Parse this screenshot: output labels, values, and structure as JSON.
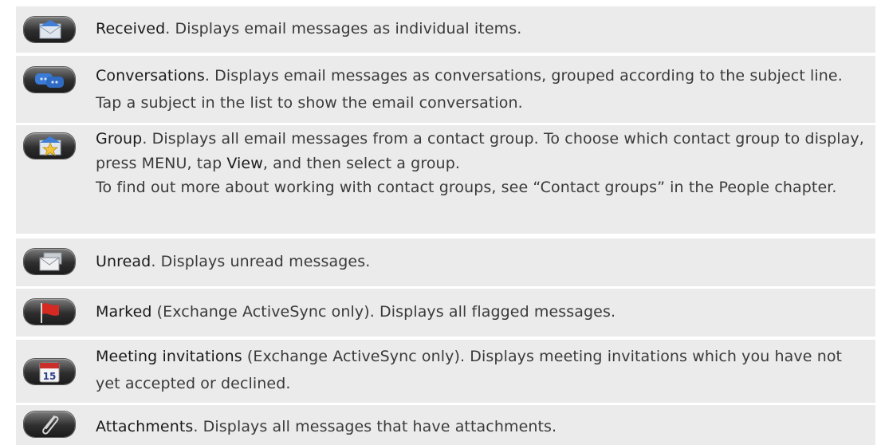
{
  "items": [
    {
      "term": "Received",
      "text": ". Displays email messages as individual items.",
      "icon": "received-envelope-icon"
    },
    {
      "term": "Conversations",
      "text": ". Displays email messages as conversations, grouped according to the subject line. Tap a subject in the list to show the email conversation.",
      "icon": "conversations-icon"
    },
    {
      "term": "Group",
      "text_a": ". Displays all email messages from a contact group. To choose which contact group to display, press MENU, tap ",
      "view": "View",
      "text_b": ", and then select a group.",
      "text_c": "To find out more about working with contact groups, see “Contact groups” in the People chapter.",
      "icon": "group-star-envelope-icon"
    },
    {
      "term": "Unread",
      "text": ". Displays unread messages.",
      "icon": "unread-envelopes-icon"
    },
    {
      "term": "Marked",
      "text": " (Exchange ActiveSync only). Displays all flagged messages.",
      "icon": "flag-icon"
    },
    {
      "term": "Meeting invitations",
      "text": " (Exchange ActiveSync only). Displays meeting invitations which you have not yet accepted or declined.",
      "icon": "calendar-icon",
      "calendar_day": "15"
    },
    {
      "term": "Attachments",
      "text": ". Displays all messages that have attachments.",
      "icon": "paperclip-icon"
    }
  ],
  "colors": {
    "row_bg": "#ebebeb",
    "text": "#3a3a3a"
  }
}
